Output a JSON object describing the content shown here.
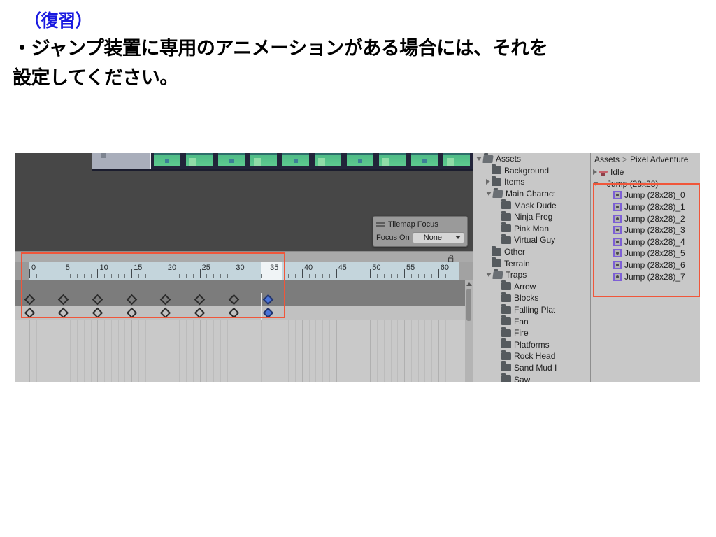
{
  "slide": {
    "heading_review": "（復習）",
    "heading_body_line1": "・ジャンプ装置に専用のアニメーションがある場合には、それを",
    "heading_body_line2": "設定してください。",
    "accent_color": "#1a1ae0",
    "annotation_color": "#f0563a"
  },
  "tilemap_focus": {
    "title": "Tilemap Focus",
    "focus_on_label": "Focus On",
    "focus_on_value": "None"
  },
  "animation_window": {
    "lock_icon": "lock-open-icon",
    "menu_icon": "kebab-menu-icon",
    "ruler": {
      "tick_labels": [
        "0",
        "5",
        "10",
        "15",
        "20",
        "25",
        "30",
        "35",
        "40",
        "45",
        "50",
        "55",
        "60"
      ],
      "playhead_frame": 34,
      "visible_range": [
        0,
        63
      ]
    },
    "keyframes": {
      "frames": [
        0,
        5,
        10,
        15,
        20,
        25,
        30,
        35
      ],
      "selected_frame": 35,
      "row_count": 2
    }
  },
  "project_tree": {
    "items": [
      {
        "label": "Assets",
        "depth": 0,
        "twirl": "open",
        "icon": "folder-open-icon"
      },
      {
        "label": "Background",
        "depth": 1,
        "twirl": "none",
        "icon": "folder-icon"
      },
      {
        "label": "Items",
        "depth": 1,
        "twirl": "closed",
        "icon": "folder-icon"
      },
      {
        "label": "Main Charact",
        "depth": 1,
        "twirl": "open",
        "icon": "folder-open-icon"
      },
      {
        "label": "Mask Dude",
        "depth": 2,
        "twirl": "none",
        "icon": "folder-icon"
      },
      {
        "label": "Ninja Frog",
        "depth": 2,
        "twirl": "none",
        "icon": "folder-icon"
      },
      {
        "label": "Pink Man",
        "depth": 2,
        "twirl": "none",
        "icon": "folder-icon"
      },
      {
        "label": "Virtual Guy",
        "depth": 2,
        "twirl": "none",
        "icon": "folder-icon"
      },
      {
        "label": "Other",
        "depth": 1,
        "twirl": "none",
        "icon": "folder-icon"
      },
      {
        "label": "Terrain",
        "depth": 1,
        "twirl": "none",
        "icon": "folder-icon"
      },
      {
        "label": "Traps",
        "depth": 1,
        "twirl": "open",
        "icon": "folder-open-icon"
      },
      {
        "label": "Arrow",
        "depth": 2,
        "twirl": "none",
        "icon": "folder-icon"
      },
      {
        "label": "Blocks",
        "depth": 2,
        "twirl": "none",
        "icon": "folder-icon"
      },
      {
        "label": "Falling Plat",
        "depth": 2,
        "twirl": "none",
        "icon": "folder-icon"
      },
      {
        "label": "Fan",
        "depth": 2,
        "twirl": "none",
        "icon": "folder-icon"
      },
      {
        "label": "Fire",
        "depth": 2,
        "twirl": "none",
        "icon": "folder-icon"
      },
      {
        "label": "Platforms",
        "depth": 2,
        "twirl": "none",
        "icon": "folder-icon"
      },
      {
        "label": "Rock Head",
        "depth": 2,
        "twirl": "none",
        "icon": "folder-icon"
      },
      {
        "label": "Sand Mud I",
        "depth": 2,
        "twirl": "none",
        "icon": "folder-icon"
      },
      {
        "label": "Saw",
        "depth": 2,
        "twirl": "none",
        "icon": "folder-icon"
      }
    ]
  },
  "asset_panel": {
    "breadcrumb": {
      "root": "Assets",
      "separator": ">",
      "current": "Pixel Adventure"
    },
    "rows": [
      {
        "label": "Idle",
        "depth": 0,
        "twirl": "closed",
        "icon": "animation-clip-icon"
      },
      {
        "label": "Jump (28x28)",
        "depth": 0,
        "twirl": "open",
        "icon": "dash-icon"
      },
      {
        "label": "Jump (28x28)_0",
        "depth": 1,
        "twirl": "none",
        "icon": "sprite-icon"
      },
      {
        "label": "Jump (28x28)_1",
        "depth": 1,
        "twirl": "none",
        "icon": "sprite-icon"
      },
      {
        "label": "Jump (28x28)_2",
        "depth": 1,
        "twirl": "none",
        "icon": "sprite-icon"
      },
      {
        "label": "Jump (28x28)_3",
        "depth": 1,
        "twirl": "none",
        "icon": "sprite-icon"
      },
      {
        "label": "Jump (28x28)_4",
        "depth": 1,
        "twirl": "none",
        "icon": "sprite-icon"
      },
      {
        "label": "Jump (28x28)_5",
        "depth": 1,
        "twirl": "none",
        "icon": "sprite-icon"
      },
      {
        "label": "Jump (28x28)_6",
        "depth": 1,
        "twirl": "none",
        "icon": "sprite-icon"
      },
      {
        "label": "Jump (28x28)_7",
        "depth": 1,
        "twirl": "none",
        "icon": "sprite-icon"
      }
    ]
  }
}
